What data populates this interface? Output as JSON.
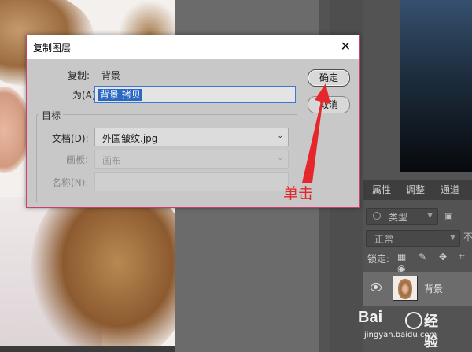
{
  "dialog": {
    "title": "复制图层",
    "source_label": "复制:",
    "source_value": "背景",
    "as_label": "为(A):",
    "as_value": "背景 拷贝",
    "target_group": "目标",
    "document_label": "文档(D):",
    "document_value": "外国皱纹.jpg",
    "artboard_label": "画板:",
    "artboard_value": "画布",
    "name_label": "名称(N):",
    "name_value": "",
    "ok_label": "确定",
    "cancel_label": "取消",
    "close_glyph": "✕"
  },
  "annotation": {
    "text": "单击",
    "color": "#e5262b"
  },
  "layers_panel": {
    "tabs": [
      "属性",
      "调整",
      "通道"
    ],
    "filter_label": "类型",
    "blend_mode": "正常",
    "opacity_label": "不",
    "lock_label": "锁定:",
    "lock_icons": "▦ ✎ ✥ ⌗ ◉",
    "layer_name": "背景"
  },
  "watermark": {
    "brand": "Bai",
    "brand2": "经验",
    "url": "jingyan.baidu.com"
  }
}
